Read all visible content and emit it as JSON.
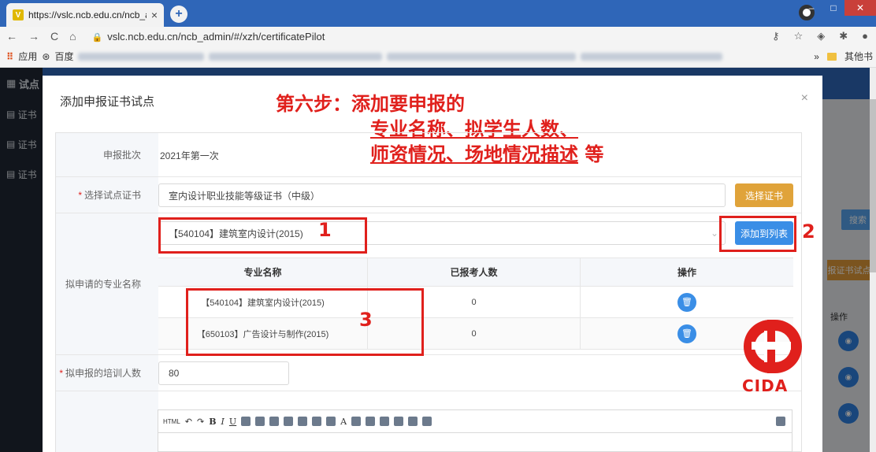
{
  "browser": {
    "tab_title": "https://vslc.ncb.edu.cn/ncb_ad",
    "tab_close": "×",
    "new_tab": "+",
    "url_host": "vslc.ncb.edu.cn",
    "url_path": "/ncb_admin/#/xzh/certificatePilot",
    "nav_back": "←",
    "nav_forward": "→",
    "nav_reload": "C",
    "nav_home": "⌂",
    "bookmark_apps": "应用",
    "bookmark_baidu": "百度",
    "bookmark_more": "»",
    "bookmark_other": "其他书"
  },
  "app": {
    "sidebar_logo": "试点",
    "sidebar_items": [
      "证书",
      "证书",
      "证书"
    ],
    "search_button": "搜索",
    "orange_button": "报证书试点",
    "op_header": "操作",
    "eye_buttons": [
      "◉",
      "◉",
      "◉"
    ]
  },
  "modal": {
    "title": "添加申报证书试点",
    "close": "×"
  },
  "annotation": {
    "line1": "第六步：添加要申报的",
    "line2": "专业名称、拟学生人数、",
    "line3": "师资情况、场地情况描述",
    "line3_suffix": "等",
    "num1": "1",
    "num2": "2",
    "num3": "3"
  },
  "form": {
    "batch_label": "申报批次",
    "batch_value": "2021年第一次",
    "cert_label": "选择试点证书",
    "cert_value": "室内设计职业技能等级证书（中级）",
    "cert_button": "选择证书",
    "major_label": "拟申请的专业名称",
    "major_select_value": "【540104】建筑室内设计(2015)",
    "add_button": "添加到列表",
    "table_headers": [
      "专业名称",
      "已报考人数",
      "操作"
    ],
    "table_rows": [
      {
        "name": "【540104】建筑室内设计(2015)",
        "count": "0"
      },
      {
        "name": "【650103】广告设计与制作(2015)",
        "count": "0"
      }
    ],
    "train_label": "拟申报的培训人数",
    "train_value": "80",
    "required_mark": "*"
  },
  "editor_toolbar": [
    "HTML",
    "B",
    "I",
    "U",
    "A"
  ],
  "logo_text": "CIDA",
  "colors": {
    "accent_blue": "#3a8ee6",
    "accent_orange": "#e0a33a",
    "annotation_red": "#e0201c",
    "browser_blue": "#2f66b8"
  }
}
